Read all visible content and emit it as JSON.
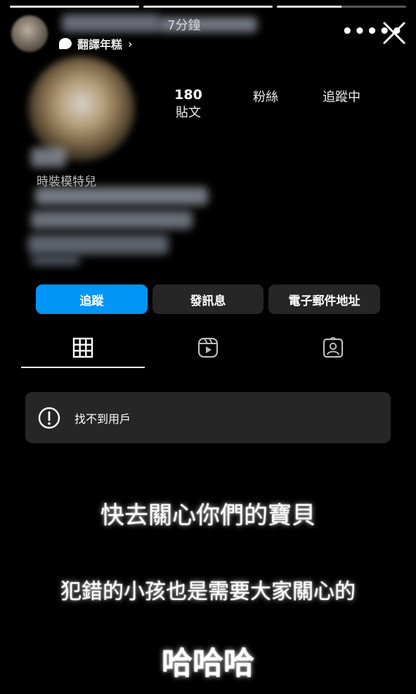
{
  "story": {
    "progress": [
      1.0,
      1.0,
      0.5
    ],
    "time": "7分鐘",
    "translate_label": "翻譯年糕",
    "translate_chevron": "›",
    "more_label": "•••••"
  },
  "profile": {
    "stats": [
      {
        "value": "180",
        "label": "貼文"
      },
      {
        "value": "",
        "label": "粉絲"
      },
      {
        "value": "",
        "label": "追蹤中"
      }
    ],
    "category": "時裝模特兒"
  },
  "actions": {
    "follow": "追蹤",
    "message": "發訊息",
    "email": "電子郵件地址"
  },
  "tabs": {
    "selected": "grid",
    "icons": [
      "grid-icon",
      "reels-icon",
      "tagged-icon"
    ]
  },
  "notice": {
    "icon": "alert-circle-icon",
    "text": "找不到用戶"
  },
  "captions": {
    "line1": "快去關心你們的寶貝",
    "line2": "犯錯的小孩也是需要大家關心的",
    "line3": "哈哈哈"
  },
  "colors": {
    "accent": "#0095f6",
    "button": "#262626",
    "background": "#000000"
  }
}
